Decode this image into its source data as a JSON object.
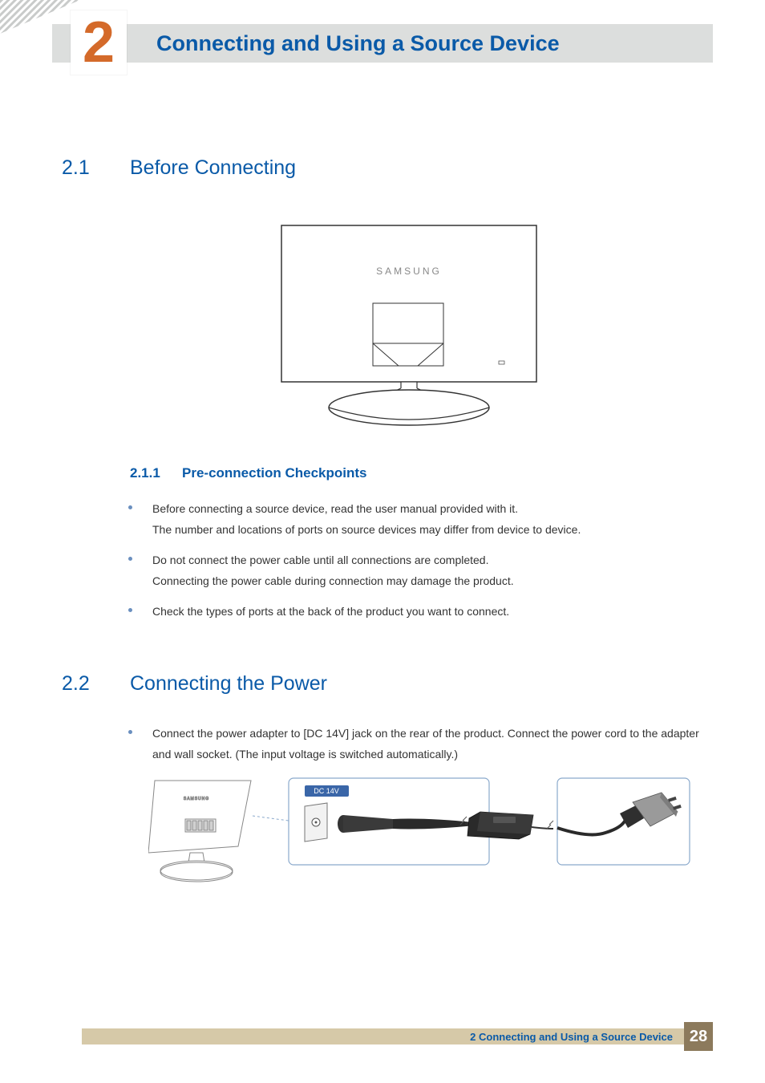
{
  "chapter": {
    "number": "2",
    "title": "Connecting and Using a Source Device"
  },
  "sections": {
    "s1": {
      "num": "2.1",
      "title": "Before Connecting"
    },
    "s1_1": {
      "num": "2.1.1",
      "title": "Pre-connection Checkpoints"
    },
    "s2": {
      "num": "2.2",
      "title": "Connecting the Power"
    }
  },
  "monitor": {
    "brand": "SAMSUNG"
  },
  "bullets1": {
    "b1a": "Before connecting a source device, read the user manual provided with it.",
    "b1b": "The number and locations of ports on source devices may differ from device to device.",
    "b2a": "Do not connect the power cable until all connections are completed.",
    "b2b": "Connecting the power cable during connection may damage the product.",
    "b3": "Check the types of ports at the back of the product you want to connect."
  },
  "bullets2": {
    "b1": "Connect the power adapter to [DC 14V] jack on the rear of the product. Connect the power cord to the adapter and wall socket. (The input voltage is switched automatically.)"
  },
  "power_label": "DC 14V",
  "footer": {
    "text": "2 Connecting and Using a Source Device",
    "page": "28"
  }
}
